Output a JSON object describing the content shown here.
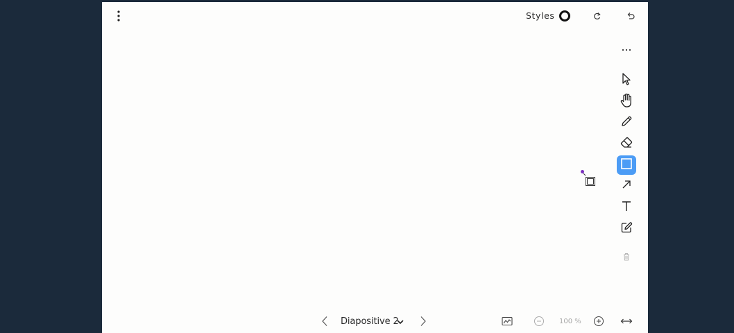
{
  "header": {
    "menu_icon": "more-vertical-icon",
    "styles_label": "Styles",
    "style_swatch_icon": "circle-outline-icon",
    "redo_icon": "redo-icon",
    "undo_icon": "undo-icon"
  },
  "toolbar": {
    "more_icon": "more-horizontal-icon",
    "tools": [
      {
        "name": "select",
        "icon": "cursor-arrow-icon",
        "active": false
      },
      {
        "name": "pan",
        "icon": "hand-icon",
        "active": false
      },
      {
        "name": "draw",
        "icon": "pencil-icon",
        "active": false
      },
      {
        "name": "eraser",
        "icon": "eraser-icon",
        "active": false
      },
      {
        "name": "rectangle",
        "icon": "square-icon",
        "active": true
      },
      {
        "name": "arrow",
        "icon": "arrow-icon",
        "active": false
      },
      {
        "name": "text",
        "icon": "text-icon",
        "active": false
      },
      {
        "name": "note",
        "icon": "edit-note-icon",
        "active": false
      },
      {
        "name": "delete",
        "icon": "trash-icon",
        "active": false
      }
    ],
    "active_color": "#4c9cf5"
  },
  "footer": {
    "slide_label": "Diapositive 2",
    "zoom_label": "100 %"
  },
  "colors": {
    "background": "#1b2a3b",
    "canvas": "#fdfdfc",
    "accent": "#4c9cf5",
    "cursor_dot": "#7b2fbf"
  }
}
